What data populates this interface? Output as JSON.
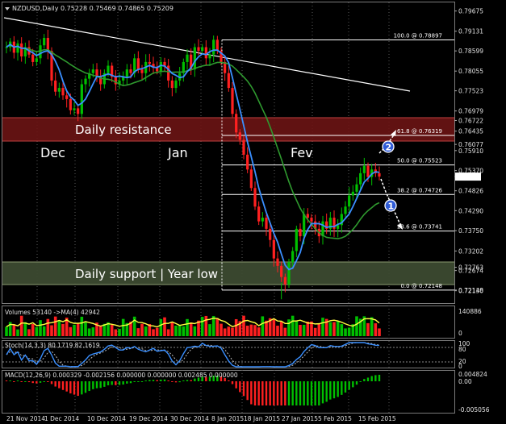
{
  "header": {
    "symbol": "NZDUSD,Daily",
    "ohlc": "0.75228 0.75469 0.74865 0.75209"
  },
  "zones": {
    "resistance_label": "Daily resistance",
    "support_label": "Daily support | Year low"
  },
  "months": {
    "dec": "Dec",
    "jan": "Jan",
    "feb": "Fev"
  },
  "fib_levels": [
    {
      "label": "100.0 @ 0.78897",
      "value": 0.78897
    },
    {
      "label": "61.8 @ 0.76319",
      "value": 0.76319
    },
    {
      "label": "50.0 @ 0.75523",
      "value": 0.75523
    },
    {
      "label": "38.2 @ 0.74726",
      "value": 0.74726
    },
    {
      "label": "23.6 @ 0.73741",
      "value": 0.73741
    },
    {
      "label": "0.0 @ 0.72148",
      "value": 0.72148
    }
  ],
  "markers": {
    "m1": "1",
    "m2": "2"
  },
  "indicators": {
    "volumes": "Volumes 53140  ->MA(4) 42942",
    "stoch": "Stoch(14,3,3) 80.1719 82.1619",
    "macd": "MACD(12,26,9) 0.000329 -0.002156 0.000000 0.000000 0.002485 0.000000"
  },
  "panel_axes": {
    "volume_top": "140886",
    "volume_bottom": "0",
    "stoch_top": "100",
    "stoch_80": "80",
    "stoch_20": "20",
    "stoch_0": "0",
    "macd_top": "0.004824",
    "macd_zero": "0.00",
    "macd_bottom": "-0.005056"
  },
  "date_labels": [
    "21 Nov 2014",
    "1 Dec 2014",
    "10 Dec 2014",
    "19 Dec 2014",
    "30 Dec 2014",
    "8 Jan 2015",
    "18 Jan 2015",
    "27 Jan 2015",
    "5 Feb 2015",
    "15 Feb 2015"
  ],
  "colors": {
    "background": "#000000",
    "bull": "#00c000",
    "bear": "#ff2020",
    "ma_fast": "#3a8fff",
    "ma_slow": "#2f9a2f",
    "resistance": "#8b1a1a",
    "support": "#4a5a3a",
    "trendline": "#ffffff"
  },
  "chart_data": {
    "type": "candlestick",
    "ylim": [
      0.71905,
      0.79842
    ],
    "price_ticks": [
      "0.79675",
      "0.79131",
      "0.78599",
      "0.78055",
      "0.77523",
      "0.76979",
      "0.76722",
      "0.76435",
      "0.76077",
      "0.75910",
      "0.75370",
      "0.75209",
      "0.74826",
      "0.74290",
      "0.73750",
      "0.73202",
      "0.72763",
      "0.72674",
      "0.72148",
      "0.72130"
    ],
    "resistance_zone": [
      0.76077,
      0.76722
    ],
    "support_zone": [
      0.72148,
      0.72763
    ]
  }
}
